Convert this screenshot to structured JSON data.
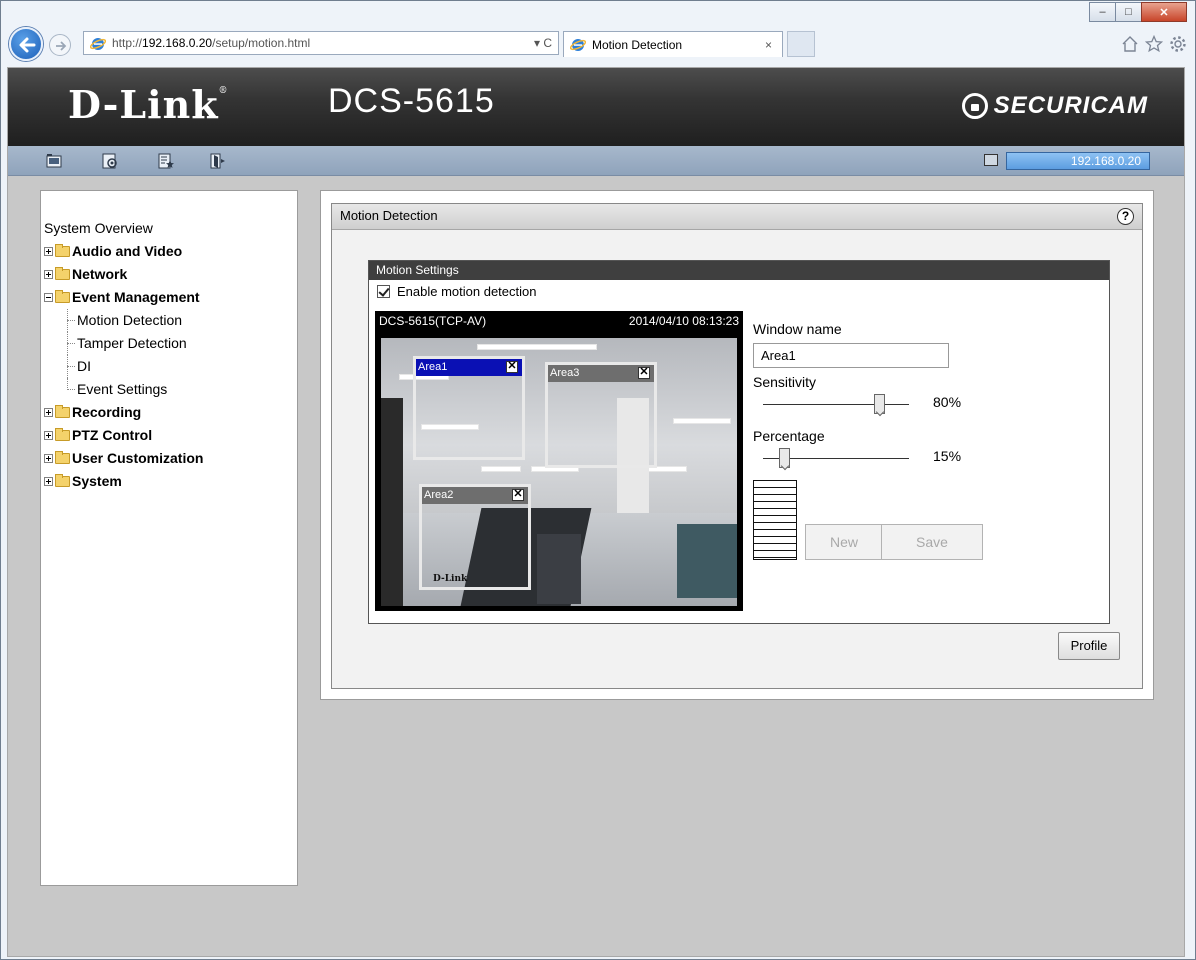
{
  "browser": {
    "url_prefix": "http://",
    "url_host": "192.168.0.20",
    "url_path": "/setup/motion.html",
    "address_controls": "▾ C",
    "tab_title": "Motion Detection",
    "tab_close": "×",
    "caption": {
      "minimize": "–",
      "maximize": "□",
      "close": "✕"
    },
    "tool_icons": [
      "home-icon",
      "favorites-icon",
      "settings-icon"
    ]
  },
  "header": {
    "brand": "D-Link",
    "brand_mark": "®",
    "model": "DCS-5615",
    "securicam": "SECURICAM"
  },
  "navbar": {
    "icons": [
      "live-video-icon",
      "setup-icon",
      "maintenance-icon",
      "logout-icon"
    ],
    "ip": "192.168.0.20"
  },
  "sidebar": {
    "overview": "System Overview",
    "groups": [
      {
        "label": "Audio and Video",
        "state": "collapsed"
      },
      {
        "label": "Network",
        "state": "collapsed"
      },
      {
        "label": "Event Management",
        "state": "expanded",
        "children": [
          "Motion Detection",
          "Tamper Detection",
          "DI",
          "Event Settings"
        ]
      },
      {
        "label": "Recording",
        "state": "collapsed"
      },
      {
        "label": "PTZ Control",
        "state": "collapsed"
      },
      {
        "label": "User Customization",
        "state": "collapsed"
      },
      {
        "label": "System",
        "state": "collapsed"
      }
    ]
  },
  "main": {
    "panel_title": "Motion Detection",
    "help": "?",
    "settings_title": "Motion Settings",
    "enable_label": "Enable motion detection",
    "enable_checked": true,
    "video": {
      "camera_name": "DCS-5615(TCP-AV)",
      "timestamp": "2014/04/10 08:13:23",
      "areas": [
        {
          "name": "Area1",
          "selected": true
        },
        {
          "name": "Area2",
          "selected": false
        },
        {
          "name": "Area3",
          "selected": false
        }
      ],
      "close_glyph": "✕",
      "desk_logo": "D-Link"
    },
    "window_name_label": "Window name",
    "window_name_value": "Area1",
    "sensitivity_label": "Sensitivity",
    "sensitivity_value": "80%",
    "sensitivity": 0.8,
    "percentage_label": "Percentage",
    "percentage_value": "15%",
    "percentage": 0.15,
    "new_button": "New",
    "save_button": "Save",
    "profile_button": "Profile"
  },
  "colors": {
    "header_bg": "#343434",
    "navbar_bg": "#9caec4",
    "ip_box": "#6ea8e6",
    "selected_area": "#0a10b4",
    "settings_title_bg": "#3f3f3f"
  }
}
